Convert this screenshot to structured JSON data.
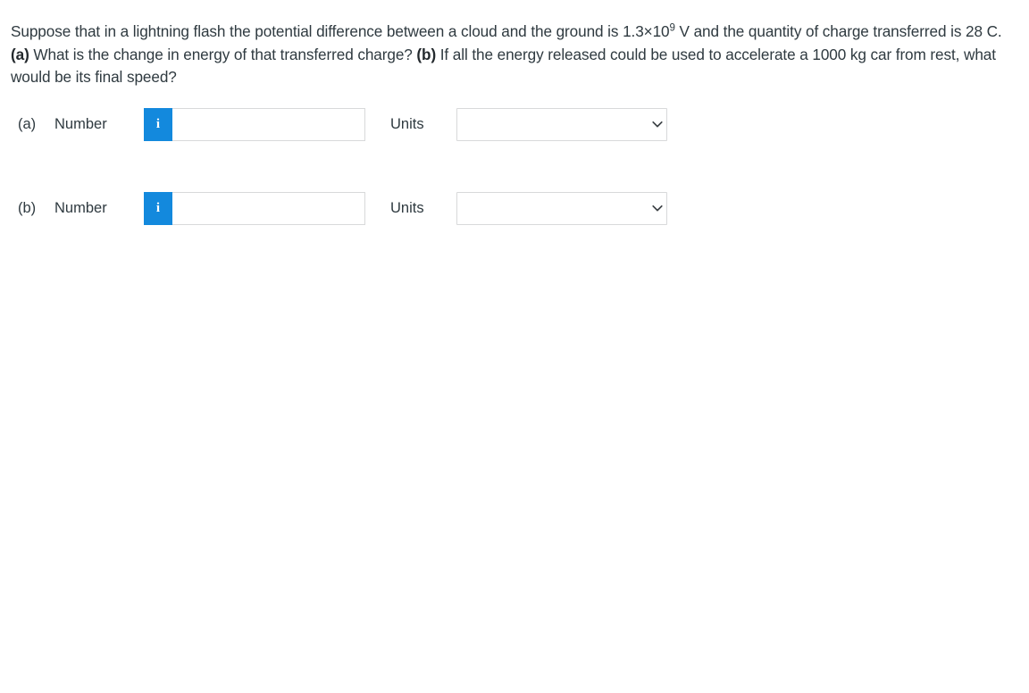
{
  "question": {
    "part1": "Suppose that in a lightning flash the potential difference between a cloud and the ground is 1.3×10",
    "exponent": "9",
    "part2": " V and the quantity of charge transferred is 28 C. ",
    "marker_a": "(a)",
    "part3": " What is the change in energy of that transferred charge? ",
    "marker_b": "(b)",
    "part4": " If all the energy released could be used to accelerate a 1000 kg car from rest, what would be its final speed?"
  },
  "rows": [
    {
      "letter": "(a)",
      "number_label": "Number",
      "info_glyph": "i",
      "number_value": "",
      "number_placeholder": "",
      "units_label": "Units",
      "units_value": "",
      "units_options": [
        ""
      ]
    },
    {
      "letter": "(b)",
      "number_label": "Number",
      "info_glyph": "i",
      "number_value": "",
      "number_placeholder": "",
      "units_label": "Units",
      "units_value": "",
      "units_options": [
        ""
      ]
    }
  ],
  "colors": {
    "info_button": "#1389dd",
    "text": "#2f3a40",
    "border": "#d8d9da",
    "background": "#ffffff"
  }
}
